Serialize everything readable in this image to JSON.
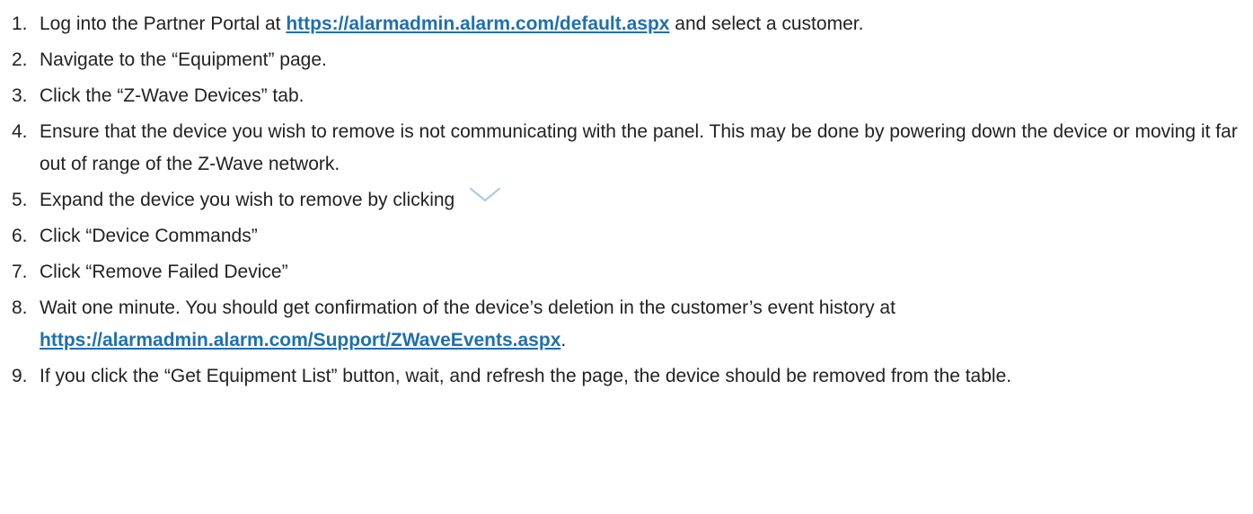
{
  "steps": [
    {
      "num": "1.",
      "before": "Log into the Partner Portal at ",
      "link": "https://alarmadmin.alarm.com/default.aspx",
      "after": " and select a customer."
    },
    {
      "num": "2.",
      "text": "Navigate to the “Equipment” page."
    },
    {
      "num": "3.",
      "text": "Click the “Z-Wave Devices” tab."
    },
    {
      "num": "4.",
      "text": "Ensure that the device you wish to remove is not communicating with the panel. This may be done by powering down the device or moving it far out of range of the Z-Wave network."
    },
    {
      "num": "5.",
      "text": "Expand the device you wish to remove by clicking",
      "icon": "chevron-down-icon"
    },
    {
      "num": "6.",
      "text": "Click “Device Commands”"
    },
    {
      "num": "7.",
      "text": "Click “Remove Failed Device”"
    },
    {
      "num": "8.",
      "before": "Wait one minute. You should get confirmation of the device’s deletion in the customer’s event history at ",
      "link": "https://alarmadmin.alarm.com/Support/ZWaveEvents.aspx",
      "after": "."
    },
    {
      "num": "9.",
      "text": "If you click the “Get Equipment List” button, wait, and refresh the page, the device should be removed from the table."
    }
  ],
  "colors": {
    "text": "#222222",
    "link": "#1f6fb0",
    "chevron": "#a9cde6"
  }
}
